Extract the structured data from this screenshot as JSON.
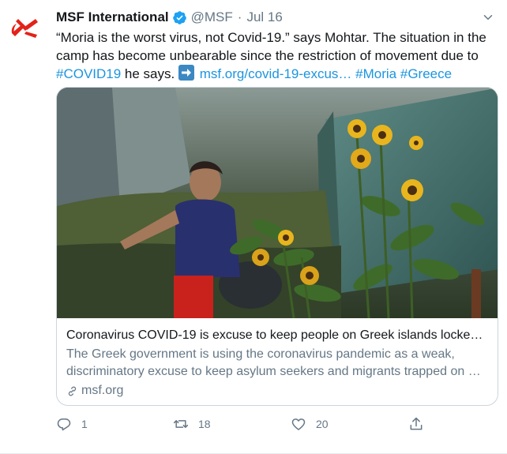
{
  "author": {
    "name": "MSF International",
    "handle": "@MSF",
    "separator": "·",
    "date": "Jul 16",
    "verified": true,
    "avatar_color": "#e32219"
  },
  "tweet": {
    "text_part1": "“Moria is the worst virus, not Covid-19.” says Mohtar. The situation in the camp has become unbearable since the restriction of movement due to ",
    "hashtag_covid": "#COVID19",
    "text_part2": " he says. ",
    "link": "msf.org/covid-19-excus…",
    "hashtag_moria": "#Moria",
    "hashtag_greece": "#Greece"
  },
  "card": {
    "title": "Coronavirus COVID-19 is excuse to keep people on Greek islands locke…",
    "description": "The Greek government is using the coronavirus pandemic as a weak, discriminatory excuse to keep asylum seekers and migrants trapped on …",
    "domain": "msf.org"
  },
  "actions": {
    "reply_count": "1",
    "retweet_count": "18",
    "like_count": "20"
  },
  "colors": {
    "link": "#1b95e0",
    "muted": "#657786",
    "border": "#ccd6dd"
  }
}
